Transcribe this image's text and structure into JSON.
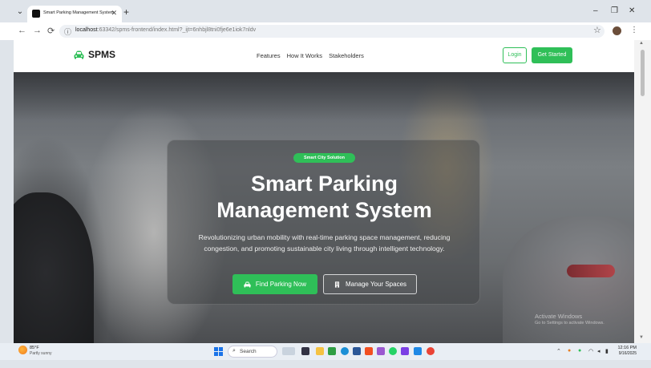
{
  "browser": {
    "tab_title": "Smart Parking Management System",
    "url_host": "localhost",
    "url_rest": ":63342/spms-frontend/index.html?_ijt=6nhbjl8tni0fje6e1iok7nldv",
    "back": "←",
    "forward": "→",
    "reload": "⟳",
    "new_tab": "+",
    "close_tab": "✕",
    "tab_menu": "⌄",
    "minimize": "–",
    "maximize": "❐",
    "close": "✕",
    "star": "☆",
    "kebab": "⋮"
  },
  "site": {
    "brand": "SPMS",
    "nav": [
      "Features",
      "How It Works",
      "Stakeholders"
    ],
    "login": "Login",
    "get_started": "Get Started",
    "accent": "#2fbf58"
  },
  "hero": {
    "badge": "Smart City Solution",
    "title_line1": "Smart Parking",
    "title_line2": "Management System",
    "subtitle": "Revolutionizing urban mobility with real-time parking space management, reducing congestion, and promoting sustainable city living through intelligent technology.",
    "btn_find": "Find Parking Now",
    "btn_manage": "Manage Your Spaces"
  },
  "watermark": {
    "title": "Activate Windows",
    "sub": "Go to Settings to activate Windows."
  },
  "taskbar": {
    "temp": "85°F",
    "weather": "Partly sunny",
    "search": "Search",
    "time": "12:16 PM",
    "date": "9/16/2025"
  }
}
